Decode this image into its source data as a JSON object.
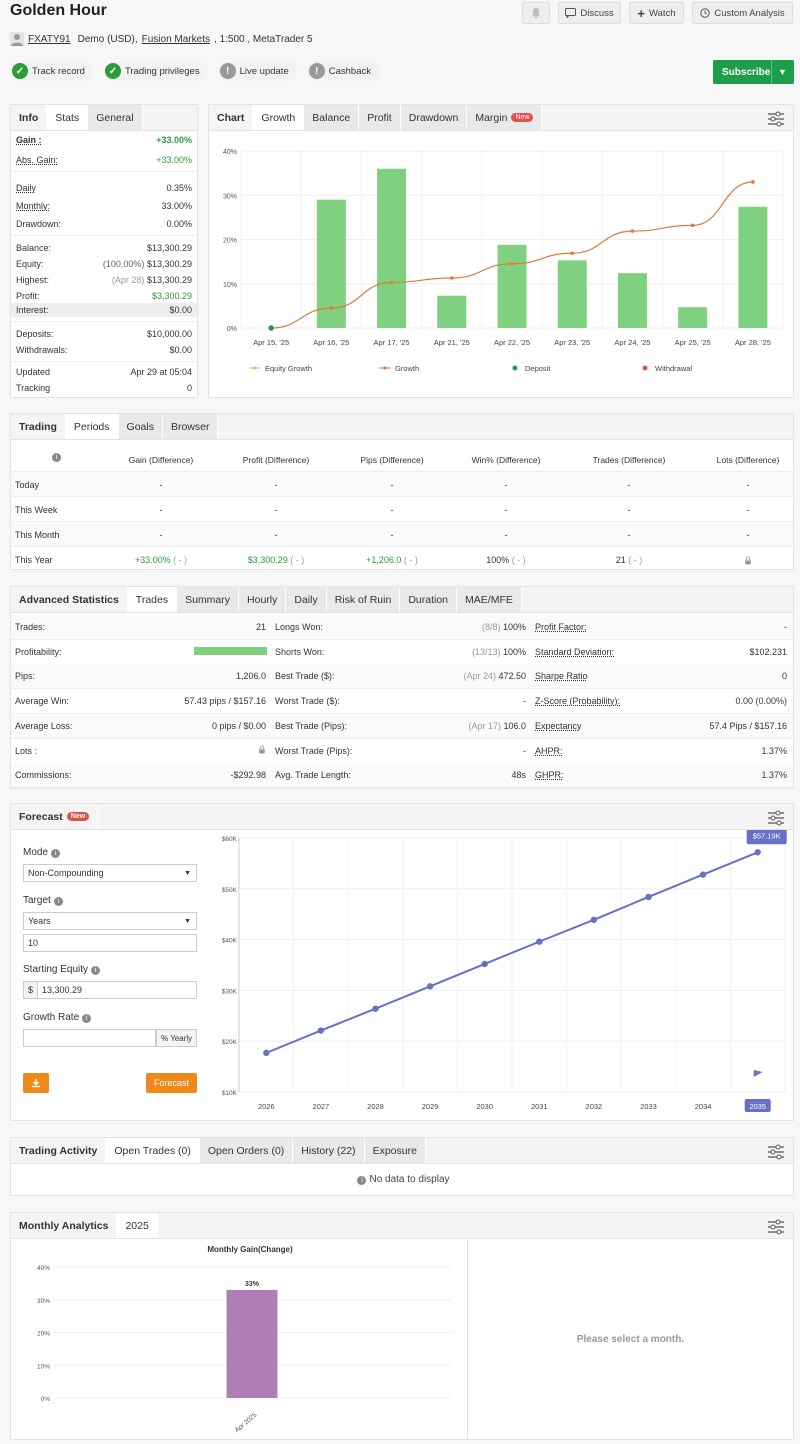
{
  "header": {
    "title": "Golden Hour",
    "account": "FXATY91",
    "account_type": "Demo (USD),",
    "broker": "Fusion Markets",
    "leverage_platform": ", 1:500 , MetaTrader 5",
    "buttons": {
      "discuss": "Discuss",
      "watch": "Watch",
      "custom_analysis": "Custom Analysis",
      "subscribe": "Subscribe"
    },
    "badges": [
      {
        "label": "Track record",
        "status": "ok"
      },
      {
        "label": "Trading privileges",
        "status": "ok"
      },
      {
        "label": "Live update",
        "status": "warn"
      },
      {
        "label": "Cashback",
        "status": "warn"
      }
    ]
  },
  "colors": {
    "green": "#2a9d3a",
    "subscribe": "#1e9e4a",
    "bar": "#7fd17f",
    "line": "#e07b3c",
    "forecast": "#6670c4",
    "monthly_bar": "#b07fb5",
    "orange_btn": "#ee8a1c"
  },
  "info": {
    "tabs": [
      "Info",
      "Stats",
      "General"
    ],
    "gain_label": "Gain :",
    "gain_value": "+33.00%",
    "abs_gain_label": "Abs. Gain:",
    "abs_gain_value": "+33.00%",
    "daily_label": "Daily",
    "daily_value": "0.35%",
    "monthly_label": "Monthly:",
    "monthly_value": "33.00%",
    "drawdown_label": "Drawdown:",
    "drawdown_value": "0.00%",
    "balance_label": "Balance:",
    "balance_value": "$13,300.29",
    "equity_label": "Equity:",
    "equity_pct": "(100.00%)",
    "equity_value": "$13,300.29",
    "highest_label": "Highest:",
    "highest_date": "(Apr 28)",
    "highest_value": "$13,300.29",
    "profit_label": "Profit:",
    "profit_value": "$3,300.29",
    "interest_label": "Interest:",
    "interest_value": "$0.00",
    "deposits_label": "Deposits:",
    "deposits_value": "$10,000.00",
    "withdrawals_label": "Withdrawals:",
    "withdrawals_value": "$0.00",
    "updated_label": "Updated",
    "updated_value": "Apr 29 at 05:04",
    "tracking_label": "Tracking",
    "tracking_value": "0"
  },
  "chart_panel": {
    "tabs": [
      "Chart",
      "Growth",
      "Balance",
      "Profit",
      "Drawdown",
      "Margin"
    ],
    "new_badge": "New",
    "legend": [
      "Equity Growth",
      "Growth",
      "Deposit",
      "Withdrawal"
    ]
  },
  "chart_data": [
    {
      "type": "bar",
      "categories": [
        "Apr 15, '25",
        "Apr 16, '25",
        "Apr 17, '25",
        "Apr 21, '25",
        "Apr 22, '25",
        "Apr 23, '25",
        "Apr 24, '25",
        "Apr 25, '25",
        "Apr 28, '25"
      ],
      "series": [
        {
          "name": "Growth",
          "type": "line",
          "values": [
            0,
            4.5,
            10.3,
            11.3,
            14.5,
            16.9,
            21.9,
            23.2,
            33.0
          ]
        },
        {
          "name": "Deposit",
          "type": "scatter",
          "values": [
            0,
            null,
            null,
            null,
            null,
            null,
            null,
            null,
            null
          ]
        },
        {
          "name": "bars",
          "type": "bar",
          "values": [
            0,
            29,
            36,
            7.3,
            18.8,
            15.3,
            12.4,
            4.7,
            27.4
          ]
        }
      ],
      "yticks": [
        "0%",
        "10%",
        "20%",
        "30%",
        "40%"
      ],
      "ylim": [
        0,
        40
      ]
    },
    {
      "type": "line",
      "x": [
        "2026",
        "2027",
        "2028",
        "2029",
        "2030",
        "2031",
        "2032",
        "2033",
        "2034",
        "2035"
      ],
      "values": [
        17.7,
        22.1,
        26.4,
        30.8,
        35.2,
        39.6,
        43.9,
        48.4,
        52.8,
        57.19
      ],
      "yticks": [
        "$10K",
        "$20K",
        "$30K",
        "$40K",
        "$50K",
        "$60K"
      ],
      "ylim": [
        10,
        60
      ],
      "end_label": "$57.19K"
    },
    {
      "type": "bar",
      "title": "Monthly Gain(Change)",
      "categories": [
        "Apr 2025"
      ],
      "values": [
        33
      ],
      "data_labels": [
        "33%"
      ],
      "yticks": [
        "0%",
        "10%",
        "20%",
        "30%",
        "40%"
      ],
      "ylim": [
        0,
        40
      ]
    }
  ],
  "trading": {
    "tabs": [
      "Trading",
      "Periods",
      "Goals",
      "Browser"
    ],
    "columns": [
      "Gain (Difference)",
      "Profit (Difference)",
      "Pips (Difference)",
      "Win% (Difference)",
      "Trades (Difference)",
      "Lots (Difference)"
    ],
    "rows": [
      {
        "label": "Today",
        "cells": [
          "-",
          "-",
          "-",
          "-",
          "-",
          "-"
        ]
      },
      {
        "label": "This Week",
        "cells": [
          "-",
          "-",
          "-",
          "-",
          "-",
          "-"
        ]
      },
      {
        "label": "This Month",
        "cells": [
          "-",
          "-",
          "-",
          "-",
          "-",
          "-"
        ]
      },
      {
        "label": "This Year",
        "cells": [
          "+33.00%",
          "$3,300.29",
          "+1,206.0",
          "100%",
          "21",
          ""
        ],
        "diff": "( - )"
      }
    ]
  },
  "advanced": {
    "tabs": [
      "Advanced Statistics",
      "Trades",
      "Summary",
      "Hourly",
      "Daily",
      "Risk of Ruin",
      "Duration",
      "MAE/MFE"
    ],
    "profitability_pct": 100,
    "rows": [
      {
        "l1": "Trades:",
        "v1": "21",
        "l2": "Longs Won:",
        "m2": "(8/8)",
        "v2": "100%",
        "l3": "Profit Factor:",
        "v3": "-"
      },
      {
        "l1": "Profitability:",
        "v1": "",
        "l2": "Shorts Won:",
        "m2": "(13/13)",
        "v2": "100%",
        "l3": "Standard Deviation:",
        "v3": "$102.231"
      },
      {
        "l1": "Pips:",
        "v1": "1,206.0",
        "l2": "Best Trade ($):",
        "m2": "(Apr 24)",
        "v2": "472.50",
        "l3": "Sharpe Ratio",
        "v3": "0"
      },
      {
        "l1": "Average Win:",
        "v1": "57.43 pips / $157.16",
        "l2": "Worst Trade ($):",
        "m2": "",
        "v2": "-",
        "l3": "Z-Score (Probability):",
        "v3": "0.00 (0.00%)"
      },
      {
        "l1": "Average Loss:",
        "v1": "0 pips / $0.00",
        "l2": "Best Trade (Pips):",
        "m2": "(Apr 17)",
        "v2": "106.0",
        "l3": "Expectancy",
        "v3": "57.4 Pips / $157.16"
      },
      {
        "l1": "Lots :",
        "v1": "",
        "l2": "Worst Trade (Pips):",
        "m2": "",
        "v2": "-",
        "l3": "AHPR:",
        "v3": "1.37%"
      },
      {
        "l1": "Commissions:",
        "v1": "-$292.98",
        "l2": "Avg. Trade Length:",
        "m2": "",
        "v2": "48s",
        "l3": "GHPR:",
        "v3": "1.37%"
      }
    ]
  },
  "forecast": {
    "title": "Forecast",
    "new_badge": "New",
    "mode_label": "Mode",
    "mode_value": "Non-Compounding",
    "target_label": "Target",
    "target_value": "Years",
    "target_number": "10",
    "equity_label": "Starting Equity",
    "currency": "$",
    "equity_value": "13,300.29",
    "growth_label": "Growth Rate",
    "growth_suffix": "% Yearly",
    "growth_value": "",
    "forecast_button": "Forecast"
  },
  "activity": {
    "tabs": [
      "Trading Activity",
      "Open Trades (0)",
      "Open Orders (0)",
      "History (22)",
      "Exposure"
    ],
    "empty": "No data to display"
  },
  "monthly": {
    "tabs": [
      "Monthly Analytics",
      "2025"
    ],
    "select_msg": "Please select a month."
  }
}
